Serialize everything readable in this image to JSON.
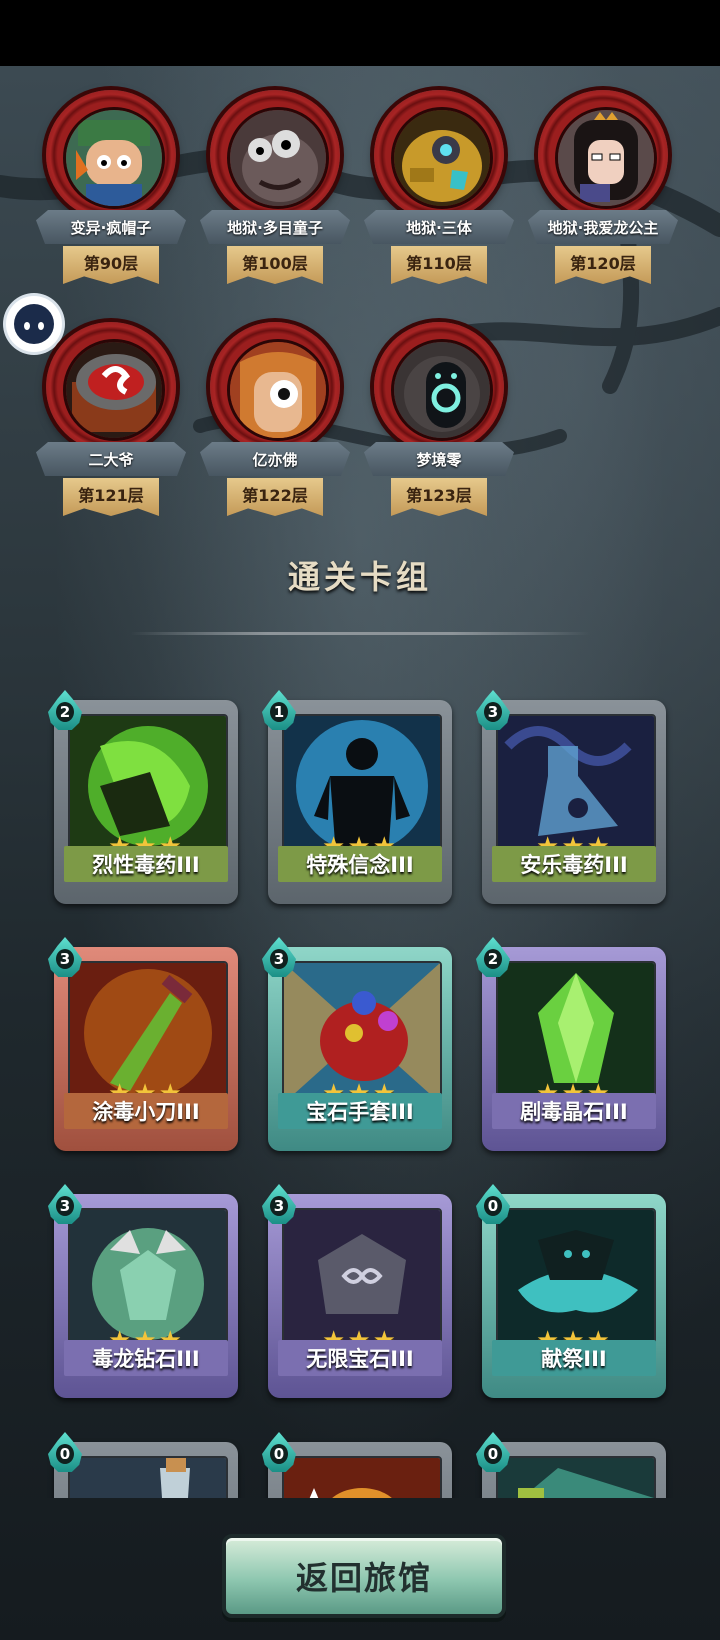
{
  "bosses": [
    {
      "name": "变异·疯帽子",
      "floor": "第90层"
    },
    {
      "name": "地狱·多目童子",
      "floor": "第100层"
    },
    {
      "name": "地狱·三体",
      "floor": "第110层"
    },
    {
      "name": "地狱·我爱龙公主",
      "floor": "第120层"
    },
    {
      "name": "二大爷",
      "floor": "第121层"
    },
    {
      "name": "亿亦佛",
      "floor": "第122层"
    },
    {
      "name": "梦境零",
      "floor": "第123层"
    }
  ],
  "section_title": "通关卡组",
  "cards": [
    {
      "cost": "2",
      "name": "烈性毒药III",
      "stars": "★★★",
      "name_color": "#7d9a47"
    },
    {
      "cost": "1",
      "name": "特殊信念III",
      "stars": "★★★",
      "name_color": "#7d9a47"
    },
    {
      "cost": "3",
      "name": "安乐毒药III",
      "stars": "★★★",
      "name_color": "#7d9a47"
    },
    {
      "cost": "3",
      "name": "涂毒小刀III",
      "stars": "★★★",
      "name_color": "#b4673d"
    },
    {
      "cost": "3",
      "name": "宝石手套III",
      "stars": "★★★",
      "name_color": "#3f9a96"
    },
    {
      "cost": "2",
      "name": "剧毒晶石III",
      "stars": "★★★",
      "name_color": "#7b6fb0"
    },
    {
      "cost": "3",
      "name": "毒龙钻石III",
      "stars": "★★★",
      "name_color": "#7b6fb0"
    },
    {
      "cost": "3",
      "name": "无限宝石III",
      "stars": "★★★",
      "name_color": "#7b6fb0"
    },
    {
      "cost": "0",
      "name": "献祭III",
      "stars": "★★★",
      "name_color": "#3f9a96"
    },
    {
      "cost": "0",
      "name": "",
      "stars": "",
      "name_color": "#7b6fb0"
    },
    {
      "cost": "0",
      "name": "",
      "stars": "",
      "name_color": "#b4673d"
    },
    {
      "cost": "0",
      "name": "",
      "stars": "",
      "name_color": "#3f9a96"
    }
  ],
  "back_button_label": "返回旅馆",
  "icons": {
    "cost": "water-drop-icon",
    "avatar": "ghost-avatar-icon"
  }
}
